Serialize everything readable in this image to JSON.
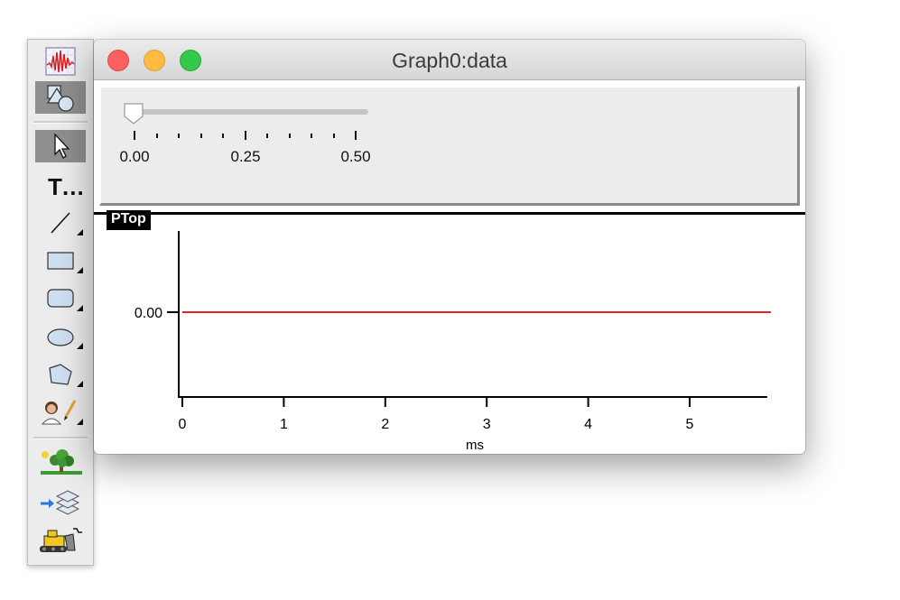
{
  "window": {
    "title": "Graph0:data"
  },
  "palette": {
    "tools": [
      {
        "name": "graph-tool",
        "icon": "waveform-icon"
      },
      {
        "name": "drawing-mode-tool",
        "icon": "shapes-icon",
        "selected": true
      },
      {
        "name": "arrow-tool",
        "icon": "arrow-cursor-icon",
        "selected": true
      },
      {
        "name": "text-tool",
        "icon": "text-icon",
        "label": "T…"
      },
      {
        "name": "line-tool",
        "icon": "line-icon"
      },
      {
        "name": "rectangle-tool",
        "icon": "rectangle-icon"
      },
      {
        "name": "rounded-rectangle-tool",
        "icon": "rounded-rectangle-icon"
      },
      {
        "name": "oval-tool",
        "icon": "oval-icon"
      },
      {
        "name": "polygon-tool",
        "icon": "polygon-icon"
      },
      {
        "name": "user-draw-tool",
        "icon": "person-pencil-icon"
      },
      {
        "name": "picture-tool",
        "icon": "tree-landscape-icon"
      },
      {
        "name": "layers-tool",
        "icon": "layers-icon"
      },
      {
        "name": "bulldozer-tool",
        "icon": "bulldozer-icon"
      }
    ]
  },
  "slider": {
    "value": 0.0,
    "min": 0.0,
    "max": 0.5,
    "tick_labels": [
      "0.00",
      "0.25",
      "0.50"
    ]
  },
  "graph": {
    "annotation": "PTop",
    "trace_color": "#e8202a"
  },
  "chart_data": {
    "type": "line",
    "title": "",
    "xlabel": "ms",
    "ylabel": "",
    "xlim": [
      0,
      5.8
    ],
    "x_ticks": [
      0,
      1,
      2,
      3,
      4,
      5
    ],
    "x_tick_labels": [
      "0",
      "1",
      "2",
      "3",
      "4",
      "5"
    ],
    "y_ticks": [
      0.0
    ],
    "y_tick_labels": [
      "0.00"
    ],
    "series": [
      {
        "x": [
          0,
          5.8
        ],
        "y": [
          0,
          0
        ],
        "color": "#e8202a"
      }
    ],
    "grid": false
  }
}
